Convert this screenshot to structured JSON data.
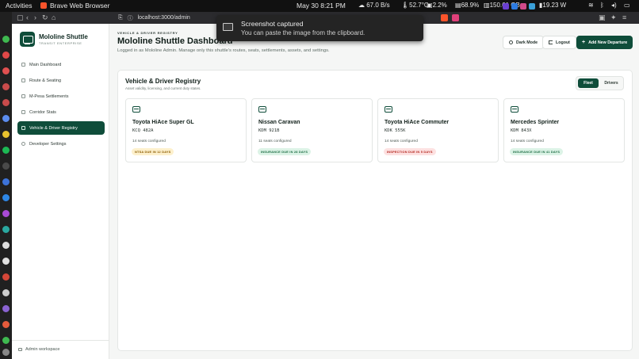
{
  "system": {
    "activities": "Activities",
    "app_name": "Brave Web Browser",
    "clock": "May 30  8:21 PM",
    "net": "67.0 B/s",
    "temp": "52.7°C",
    "cpu": "2.2%",
    "mem": "68.9%",
    "disk": "150.61 GB",
    "power": "19.23 W"
  },
  "browser": {
    "url": "localhost:3000/admin"
  },
  "notification": {
    "title": "Screenshot captured",
    "body": "You can paste the image from the clipboard."
  },
  "sidebar": {
    "brand_name": "Mololine Shuttle",
    "brand_sub": "TRANSIT ENTERPRISE",
    "items": [
      {
        "label": "Main Dashboard"
      },
      {
        "label": "Route & Seating"
      },
      {
        "label": "M-Pesa Settlements"
      },
      {
        "label": "Corridor Stats"
      },
      {
        "label": "Vehicle & Driver Registry"
      },
      {
        "label": "Developer Settings"
      }
    ],
    "workspace": "Admin workspace"
  },
  "header": {
    "kicker": "VEHICLE & DRIVER REGISTRY",
    "title": "Mololine Shuttle Dashboard",
    "subtitle": "Logged in as Mololine Admin. Manage only this shuttle's routes, seats, settlements, assets, and settings.",
    "dark_mode": "Dark Mode",
    "logout": "Logout",
    "add_departure": "Add New Departure"
  },
  "registry": {
    "title": "Vehicle & Driver Registry",
    "subtitle": "Asset validity, licensing, and current duty states.",
    "tab_fleet": "Fleet",
    "tab_drivers": "Drivers",
    "vehicles": [
      {
        "name": "Toyota HiAce Super GL",
        "plate": "KCQ 482A",
        "seats": "14 seats configured",
        "badge": "NTSA DUE IN 12 DAYS",
        "badge_bg": "#fdf0cc",
        "badge_fg": "#8a5a00"
      },
      {
        "name": "Nissan Caravan",
        "plate": "KDM 921B",
        "seats": "11 seats configured",
        "badge": "INSURANCE DUE IN 28 DAYS",
        "badge_bg": "#dcf3e6",
        "badge_fg": "#1b6b43"
      },
      {
        "name": "Toyota HiAce Commuter",
        "plate": "KDK 555K",
        "seats": "14 seats configured",
        "badge": "INSPECTION DUE IN 5 DAYS",
        "badge_bg": "#fde1e1",
        "badge_fg": "#b3261e"
      },
      {
        "name": "Mercedes Sprinter",
        "plate": "KDM 843X",
        "seats": "14 seats configured",
        "badge": "INSURANCE DUE IN 41 DAYS",
        "badge_bg": "#dcf3e6",
        "badge_fg": "#1b6b43"
      }
    ]
  }
}
